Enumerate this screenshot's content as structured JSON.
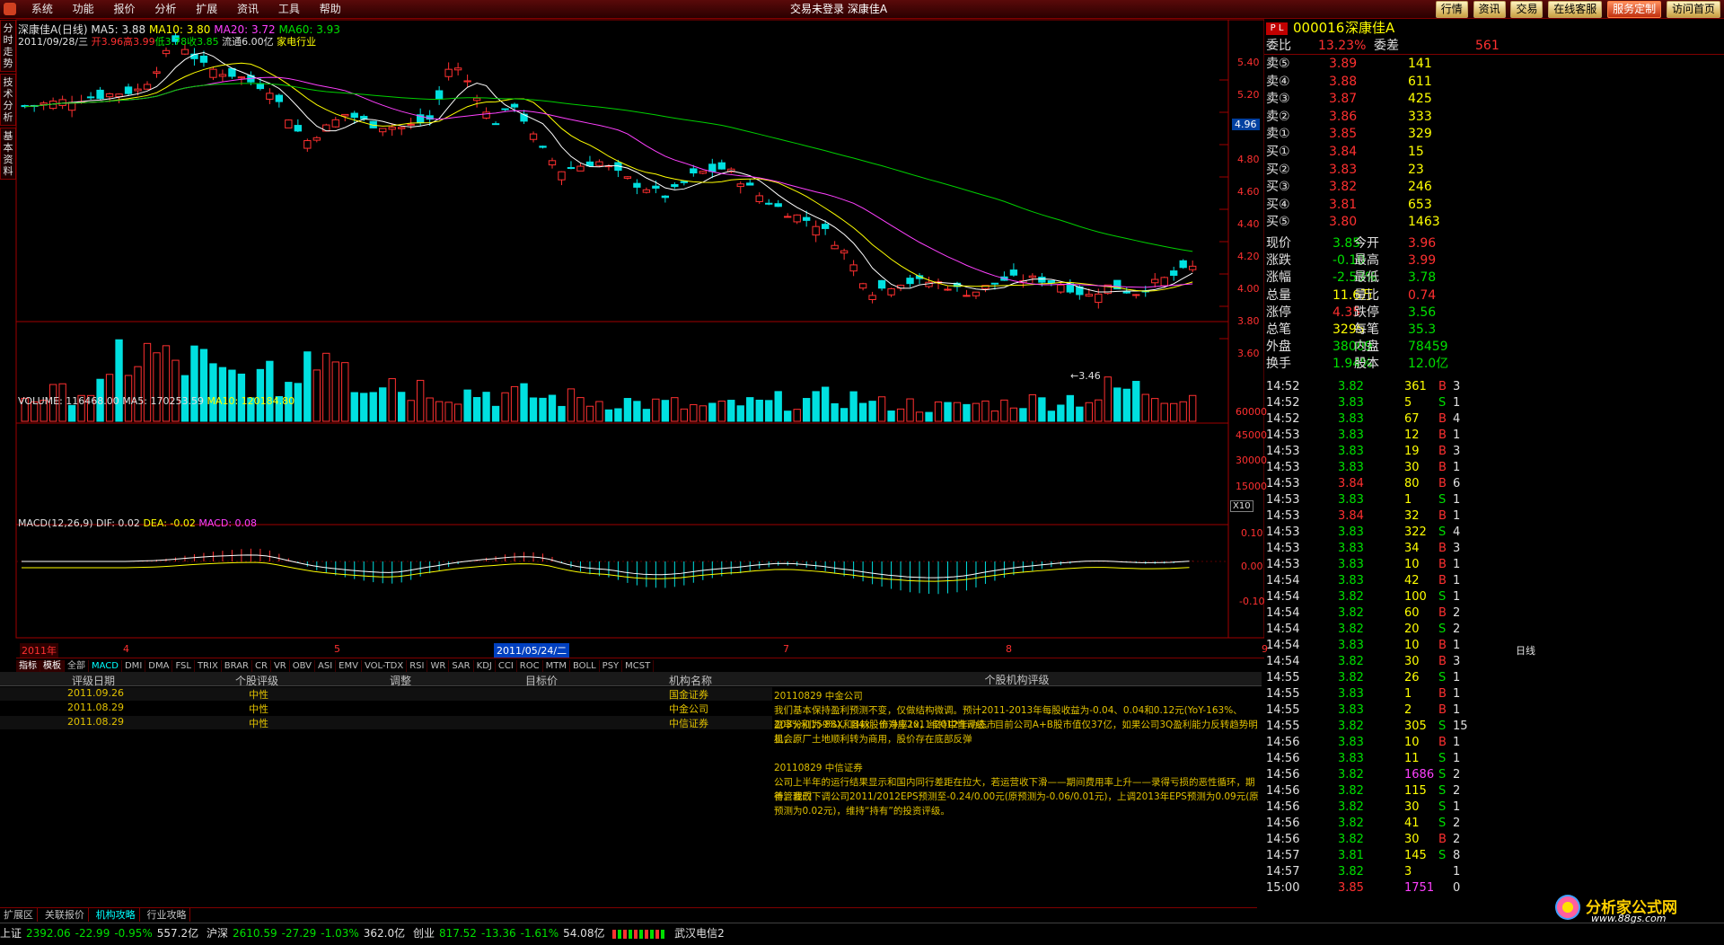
{
  "menu": [
    "系统",
    "功能",
    "报价",
    "分析",
    "扩展",
    "资讯",
    "工具",
    "帮助"
  ],
  "window_title": "交易未登录  深康佳A",
  "top_buttons": [
    "行情",
    "资讯",
    "交易",
    "在线客服",
    "服务定制",
    "访问首页"
  ],
  "left_tabs": [
    "分时走势",
    "技术分析",
    "基本资料"
  ],
  "chart": {
    "title": "深康佳A(日线)",
    "ma5_label": "MA5: 3.88",
    "ma10_label": "MA10: 3.80",
    "ma20_label": "MA20: 3.72",
    "ma60_label": "MA60: 3.93",
    "info_line_date": "2011/09/28/三",
    "info_open": "开3.96",
    "info_high": "高3.99",
    "info_low": "低3.78",
    "info_close": "收3.85",
    "info_float": "流通6.00亿",
    "info_industry": "家电行业",
    "low_mark": "←3.46",
    "price_ticks": [
      "5.40",
      "5.20",
      "5.00",
      "4.80",
      "4.60",
      "4.40",
      "4.20",
      "4.00",
      "3.80",
      "3.60"
    ],
    "cur_price_tag": "4.96",
    "volume_label": "VOLUME: 116468.00",
    "vol_ma5": "MA5: 170253.59",
    "vol_ma10": "MA10: 120184.80",
    "vol_ticks": [
      "60000",
      "45000",
      "30000",
      "15000"
    ],
    "vol_unit": "X10",
    "macd_label": "MACD(12,26,9)",
    "macd_dif": "DIF: 0.02",
    "macd_dea": "DEA: -0.02",
    "macd_val": "MACD: 0.08",
    "macd_ticks": [
      "0.10",
      "0.00",
      "-0.10"
    ],
    "date_year": "2011年",
    "date_months": [
      "4",
      "5",
      "7",
      "8",
      "9"
    ],
    "date_cursor": "2011/05/24/二",
    "period": "日线"
  },
  "chart_data": {
    "type": "candlestick",
    "title": "深康佳A(日线)",
    "ylim": [
      3.46,
      5.5
    ],
    "last_close": 3.85,
    "ma_values": {
      "MA5": 3.88,
      "MA10": 3.8,
      "MA20": 3.72,
      "MA60": 3.93
    },
    "low_point": 3.46,
    "volume_latest": 116468.0,
    "volume_ma5": 170253.59,
    "volume_ma10": 120184.8,
    "macd": {
      "DIF": 0.02,
      "DEA": -0.02,
      "MACD": 0.08
    }
  },
  "indicator_tabs": [
    "指标",
    "模板",
    "全部",
    "MACD",
    "DMI",
    "DMA",
    "FSL",
    "TRIX",
    "BRAR",
    "CR",
    "VR",
    "OBV",
    "ASI",
    "EMV",
    "VOL-TDX",
    "RSI",
    "WR",
    "SAR",
    "KDJ",
    "CCI",
    "ROC",
    "MTM",
    "BOLL",
    "PSY",
    "MCST"
  ],
  "rating": {
    "headers": [
      "评级日期",
      "个股评级",
      "调整",
      "目标价",
      "机构名称"
    ],
    "rows": [
      {
        "date": "2011.09.26",
        "rating": "中性",
        "adjust": "",
        "target": "",
        "org": "国金证券"
      },
      {
        "date": "2011.08.29",
        "rating": "中性",
        "adjust": "",
        "target": "",
        "org": "中金公司"
      },
      {
        "date": "2011.08.29",
        "rating": "中性",
        "adjust": "",
        "target": "",
        "org": "中信证券"
      }
    ],
    "comment_header": "个股机构评级",
    "comments": [
      "20110829  中金公司",
      "      我们基本保持盈利预测不变，仅做结构微调。预计2011-2013年每股收益为-0.04、0.04和0.12元(YoY-163%、203%和159%)。目前股价对应2011-2012年动态市",
      "盈率分别为-88X和84x，市净率1x，维持中性评级。目前公司A+B股市值仅37亿，如果公司3Q盈利能力反转趋势明显，原厂土地顺利转为商用，股价存在底部反弹",
      "机会。",
      "",
      "20110829  中信证券",
      "      公司上半年的运行结果显示和国内同行差距在拉大，若运营收下滑——期间费用率上升——录得亏损的恶性循环，期待管理改",
      "善。我们下调公司2011/2012EPS预测至-0.24/0.00元(原预测为-0.06/0.01元)，上调2013年EPS预测为0.09元(原预测为0.02元)，维持“持有”的投资评级。"
    ]
  },
  "bottom_tabs": [
    "扩展区",
    "关联报价",
    "机构攻略",
    "行业攻略"
  ],
  "status": {
    "sh_name": "上证",
    "sh_val": "2392.06",
    "sh_chg": "-22.99",
    "sh_pct": "-0.95%",
    "sh_amt": "557.2亿",
    "hs_name": "沪深",
    "hs_val": "2610.59",
    "hs_chg": "-27.29",
    "hs_pct": "-1.03%",
    "hs_amt": "362.0亿",
    "cy_name": "创业",
    "cy_val": "817.52",
    "cy_chg": "-13.36",
    "cy_pct": "-1.61%",
    "cy_amt": "54.08亿",
    "server": "武汉电信2"
  },
  "panel": {
    "code": "000016",
    "name": "深康佳A",
    "wb_label": "委比",
    "wb": "13.23%",
    "wc_label": "委差",
    "wc": "561",
    "sells": [
      {
        "l": "卖⑤",
        "p": "3.89",
        "v": "141"
      },
      {
        "l": "卖④",
        "p": "3.88",
        "v": "611"
      },
      {
        "l": "卖③",
        "p": "3.87",
        "v": "425"
      },
      {
        "l": "卖②",
        "p": "3.86",
        "v": "333"
      },
      {
        "l": "卖①",
        "p": "3.85",
        "v": "329"
      }
    ],
    "buys": [
      {
        "l": "买①",
        "p": "3.84",
        "v": "15"
      },
      {
        "l": "买②",
        "p": "3.83",
        "v": "23"
      },
      {
        "l": "买③",
        "p": "3.82",
        "v": "246"
      },
      {
        "l": "买④",
        "p": "3.81",
        "v": "653"
      },
      {
        "l": "买⑤",
        "p": "3.80",
        "v": "1463"
      }
    ],
    "stats": [
      {
        "a": "现价",
        "av": "3.85",
        "b": "今开",
        "bv": "3.96"
      },
      {
        "a": "涨跌",
        "av": "-0.10",
        "b": "最高",
        "bv": "3.99"
      },
      {
        "a": "涨幅",
        "av": "-2.53%",
        "b": "最低",
        "bv": "3.78"
      },
      {
        "a": "总量",
        "av": "11.6万",
        "b": "量比",
        "bv": "0.74"
      },
      {
        "a": "涨停",
        "av": "4.35",
        "b": "跌停",
        "bv": "3.56"
      },
      {
        "a": "总笔",
        "av": "3295",
        "b": "每笔",
        "bv": "35.3"
      },
      {
        "a": "外盘",
        "av": "38009",
        "b": "内盘",
        "bv": "78459"
      },
      {
        "a": "换手",
        "av": "1.94%",
        "b": "股本",
        "bv": "12.0亿"
      }
    ],
    "ticks": [
      {
        "t": "14:52",
        "p": "3.82",
        "v": "361",
        "d": "B",
        "n": "3"
      },
      {
        "t": "14:52",
        "p": "3.83",
        "v": "5",
        "d": "S",
        "n": "1"
      },
      {
        "t": "14:52",
        "p": "3.83",
        "v": "67",
        "d": "B",
        "n": "4"
      },
      {
        "t": "14:53",
        "p": "3.83",
        "v": "12",
        "d": "B",
        "n": "1"
      },
      {
        "t": "14:53",
        "p": "3.83",
        "v": "19",
        "d": "B",
        "n": "3"
      },
      {
        "t": "14:53",
        "p": "3.83",
        "v": "30",
        "d": "B",
        "n": "1"
      },
      {
        "t": "14:53",
        "p": "3.84",
        "v": "80",
        "d": "B",
        "n": "6"
      },
      {
        "t": "14:53",
        "p": "3.83",
        "v": "1",
        "d": "S",
        "n": "1"
      },
      {
        "t": "14:53",
        "p": "3.84",
        "v": "32",
        "d": "B",
        "n": "1"
      },
      {
        "t": "14:53",
        "p": "3.83",
        "v": "322",
        "d": "S",
        "n": "4"
      },
      {
        "t": "14:53",
        "p": "3.83",
        "v": "34",
        "d": "B",
        "n": "3"
      },
      {
        "t": "14:53",
        "p": "3.83",
        "v": "10",
        "d": "B",
        "n": "1"
      },
      {
        "t": "14:54",
        "p": "3.83",
        "v": "42",
        "d": "B",
        "n": "1"
      },
      {
        "t": "14:54",
        "p": "3.82",
        "v": "100",
        "d": "S",
        "n": "1"
      },
      {
        "t": "14:54",
        "p": "3.82",
        "v": "60",
        "d": "B",
        "n": "2"
      },
      {
        "t": "14:54",
        "p": "3.82",
        "v": "20",
        "d": "S",
        "n": "2"
      },
      {
        "t": "14:54",
        "p": "3.83",
        "v": "10",
        "d": "B",
        "n": "1"
      },
      {
        "t": "14:54",
        "p": "3.82",
        "v": "30",
        "d": "B",
        "n": "3"
      },
      {
        "t": "14:55",
        "p": "3.82",
        "v": "26",
        "d": "S",
        "n": "1"
      },
      {
        "t": "14:55",
        "p": "3.83",
        "v": "1",
        "d": "B",
        "n": "1"
      },
      {
        "t": "14:55",
        "p": "3.83",
        "v": "2",
        "d": "B",
        "n": "1"
      },
      {
        "t": "14:55",
        "p": "3.82",
        "v": "305",
        "d": "S",
        "n": "15"
      },
      {
        "t": "14:56",
        "p": "3.83",
        "v": "10",
        "d": "B",
        "n": "1"
      },
      {
        "t": "14:56",
        "p": "3.83",
        "v": "11",
        "d": "S",
        "n": "1"
      },
      {
        "t": "14:56",
        "p": "3.82",
        "v": "1686",
        "d": "S",
        "n": "2"
      },
      {
        "t": "14:56",
        "p": "3.82",
        "v": "115",
        "d": "S",
        "n": "2"
      },
      {
        "t": "14:56",
        "p": "3.82",
        "v": "30",
        "d": "S",
        "n": "1"
      },
      {
        "t": "14:56",
        "p": "3.82",
        "v": "41",
        "d": "S",
        "n": "2"
      },
      {
        "t": "14:56",
        "p": "3.82",
        "v": "30",
        "d": "B",
        "n": "2"
      },
      {
        "t": "14:57",
        "p": "3.81",
        "v": "145",
        "d": "S",
        "n": "8"
      },
      {
        "t": "14:57",
        "p": "3.82",
        "v": "3",
        "d": "",
        "n": "1"
      },
      {
        "t": "15:00",
        "p": "3.85",
        "v": "1751",
        "d": "",
        "n": "0"
      }
    ]
  },
  "brand": {
    "name": "分析家公式网",
    "url": "www.88gs.com"
  },
  "colors": {
    "up": "#ff3030",
    "down": "#00e0e0",
    "ma5": "#ffffff",
    "ma10": "#ffff00",
    "ma20": "#ff40ff",
    "ma60": "#00d000"
  }
}
